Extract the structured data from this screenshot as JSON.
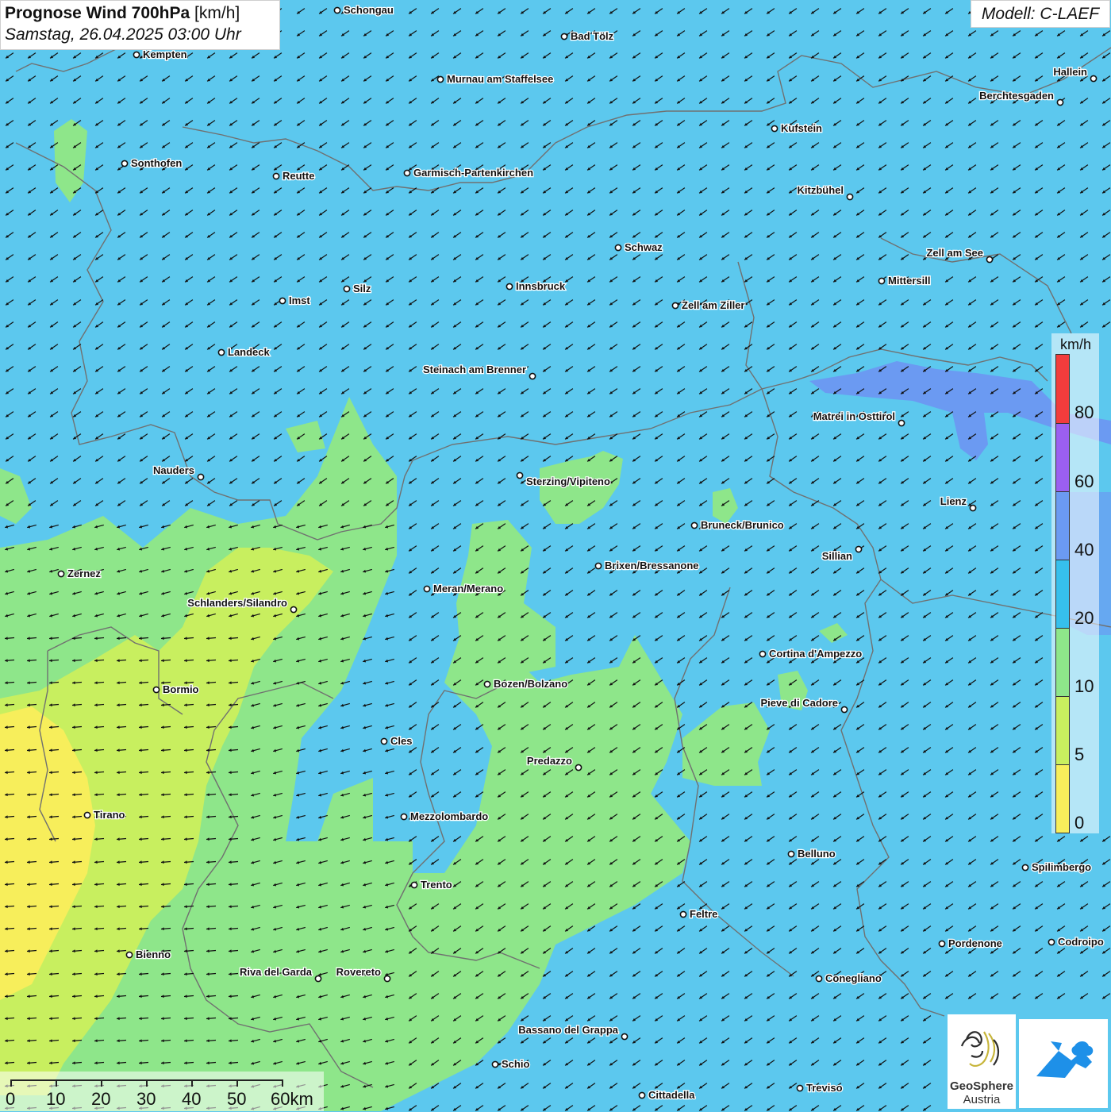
{
  "header": {
    "title_bold": "Prognose Wind 700hPa",
    "title_unit": "[km/h]",
    "datetime": "Samstag, 26.04.2025 03:00 Uhr",
    "model": "Modell: C-LAEF"
  },
  "colors": {
    "band_0": "#f7ee5b",
    "band_5": "#c8ef5f",
    "band_10": "#8ee68a",
    "band_20": "#5cc8ee",
    "band_40": "#6b9af2",
    "band_60": "#9b5ff0",
    "band_80": "#f23c3c",
    "border": "#6e6e6e"
  },
  "legend": {
    "unit": "km/h",
    "ticks": [
      "80",
      "60",
      "40",
      "20",
      "10",
      "5",
      "0"
    ]
  },
  "wind": {
    "direction": "from north-east",
    "arrow_icon": "wind-arrow-icon"
  },
  "cities": [
    {
      "name": "Schongau"
    },
    {
      "name": "Bad Tölz"
    },
    {
      "name": "Kempten"
    },
    {
      "name": "Murnau am Staffelsee"
    },
    {
      "name": "Hallein"
    },
    {
      "name": "Berchtesgaden"
    },
    {
      "name": "Kufstein"
    },
    {
      "name": "Sonthofen"
    },
    {
      "name": "Reutte"
    },
    {
      "name": "Garmisch-Partenkirchen"
    },
    {
      "name": "Kitzbühel"
    },
    {
      "name": "Schwaz"
    },
    {
      "name": "Zell am See"
    },
    {
      "name": "Mittersill"
    },
    {
      "name": "Innsbruck"
    },
    {
      "name": "Silz"
    },
    {
      "name": "Imst"
    },
    {
      "name": "Zell am Ziller"
    },
    {
      "name": "Landeck"
    },
    {
      "name": "Steinach am Brenner"
    },
    {
      "name": "Matrei in Osttirol"
    },
    {
      "name": "Nauders"
    },
    {
      "name": "Sterzing/Vipiteno"
    },
    {
      "name": "Lienz"
    },
    {
      "name": "Bruneck/Brunico"
    },
    {
      "name": "Sillian"
    },
    {
      "name": "Brixen/Bressanone"
    },
    {
      "name": "Zernez"
    },
    {
      "name": "Meran/Merano"
    },
    {
      "name": "Schlanders/Silandro"
    },
    {
      "name": "Cortina d'Ampezzo"
    },
    {
      "name": "Bozen/Bolzano"
    },
    {
      "name": "Bormio"
    },
    {
      "name": "Pieve di Cadore"
    },
    {
      "name": "Cles"
    },
    {
      "name": "Predazzo"
    },
    {
      "name": "Tirano"
    },
    {
      "name": "Mezzolombardo"
    },
    {
      "name": "Belluno"
    },
    {
      "name": "Spilimbergo"
    },
    {
      "name": "Trento"
    },
    {
      "name": "Feltre"
    },
    {
      "name": "Pordenone"
    },
    {
      "name": "Codroipo"
    },
    {
      "name": "Bienno"
    },
    {
      "name": "Riva del Garda"
    },
    {
      "name": "Rovereto"
    },
    {
      "name": "Conegliano"
    },
    {
      "name": "Bassano del Grappa"
    },
    {
      "name": "Schio"
    },
    {
      "name": "Treviso"
    },
    {
      "name": "Cittadella"
    }
  ],
  "scale": {
    "labels": [
      "0",
      "10",
      "20",
      "30",
      "40",
      "50",
      "60km"
    ]
  },
  "logo": {
    "line1": "GeoSphere",
    "line2": "Austria"
  }
}
